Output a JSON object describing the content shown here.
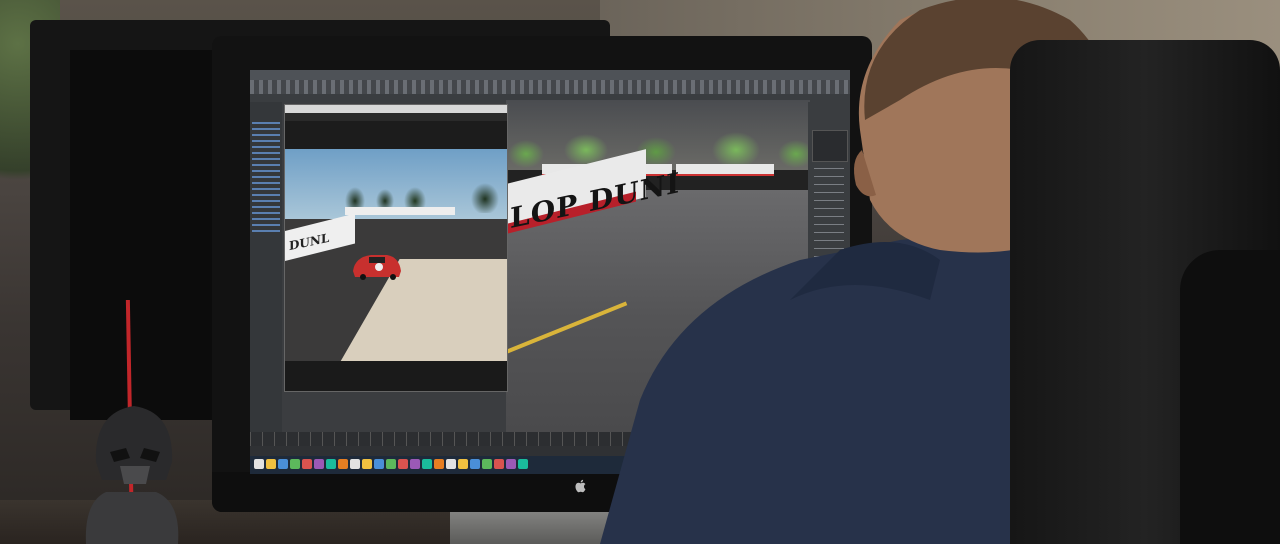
{
  "scene": {
    "description_tag": "person-at-3d-modeling-workstation",
    "software_colors": {
      "panel_bg": "#3b3d40",
      "toolbar": "#44474b",
      "taskbar": "#1e2a3a",
      "selection": "#3d78c8"
    },
    "viewport": {
      "banner_text": "LOP DUNI",
      "car_color": "#d8202a"
    },
    "reference_photo": {
      "banner_text": "DUNL",
      "car_color": "#c8302e"
    },
    "taskbar_icons": [
      "start-icon",
      "folder-icon",
      "browser-icon",
      "app-icon",
      "app-icon",
      "app-icon",
      "app-icon",
      "app-icon",
      "app-icon",
      "app-icon",
      "app-icon",
      "app-icon",
      "app-icon",
      "app-icon",
      "app-icon",
      "app-icon",
      "app-icon",
      "app-icon",
      "app-icon",
      "app-icon",
      "app-icon",
      "app-icon",
      "app-icon"
    ]
  }
}
